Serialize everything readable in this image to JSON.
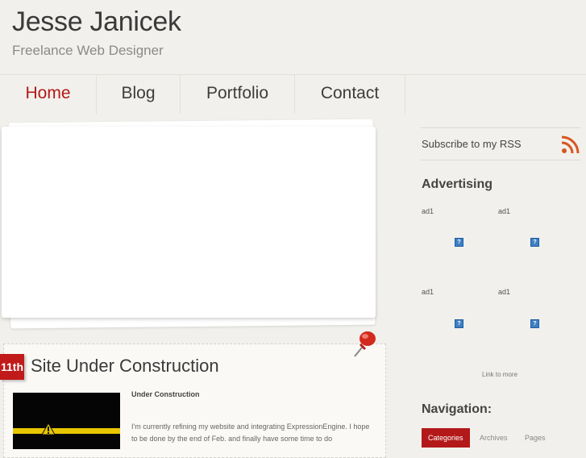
{
  "header": {
    "title": "Jesse Janicek",
    "tagline": "Freelance Web Designer"
  },
  "nav": {
    "items": [
      {
        "label": "Home",
        "active": true
      },
      {
        "label": "Blog"
      },
      {
        "label": "Portfolio"
      },
      {
        "label": "Contact"
      }
    ]
  },
  "post": {
    "date": "11th",
    "title": "Site Under Construction",
    "subtitle": "Under Construction",
    "excerpt": "I'm currently refining my website and integrating ExpressionEngine. I hope to be done by the end of Feb. and finally have some time to do"
  },
  "sidebar": {
    "rss_label": "Subscribe to my RSS",
    "advertising_heading": "Advertising",
    "ads": [
      {
        "label": "ad1"
      },
      {
        "label": "ad1"
      },
      {
        "label": "ad1"
      },
      {
        "label": "ad1"
      }
    ],
    "link_to_more": "Link to more",
    "navigation_heading": "Navigation:",
    "tabs": [
      {
        "label": "Categories",
        "active": true
      },
      {
        "label": "Archives"
      },
      {
        "label": "Pages"
      }
    ]
  },
  "colors": {
    "accent": "#b31919",
    "background": "#f1f0ec"
  }
}
